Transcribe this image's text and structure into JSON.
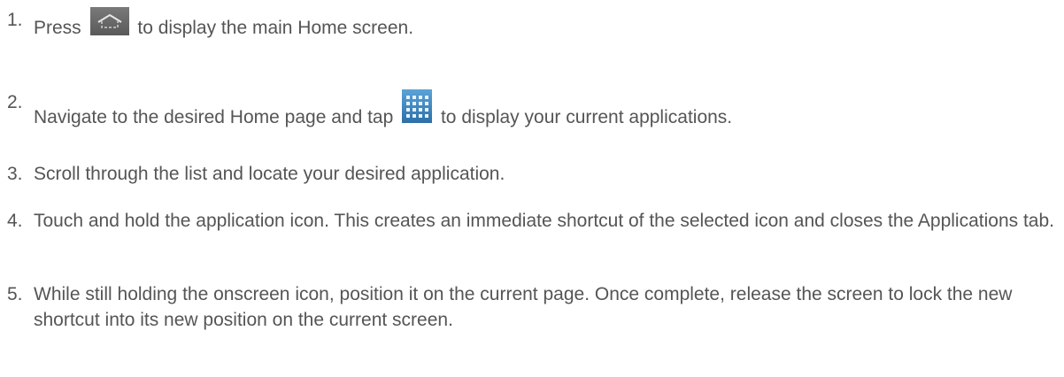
{
  "steps": [
    {
      "number": "1.",
      "before": "Press",
      "icon": "home-icon",
      "after": "to display the main Home screen."
    },
    {
      "number": "2.",
      "before": "Navigate to the desired Home page and tap",
      "icon": "apps-grid-icon",
      "after": "to display your current applications."
    },
    {
      "number": "3.",
      "text": "Scroll through the list and locate your desired application."
    },
    {
      "number": "4.",
      "text": "Touch and hold the application icon. This creates an immediate shortcut of the selected icon and closes the Applications tab."
    },
    {
      "number": "5.",
      "text": "While still holding the onscreen icon, position it on the current page. Once complete, release the screen to lock the new shortcut into its new position on the current screen."
    }
  ],
  "colors": {
    "text": "#555555",
    "home_icon_bg": "#6a6a6a",
    "apps_icon_bg": "#3b82c4"
  }
}
